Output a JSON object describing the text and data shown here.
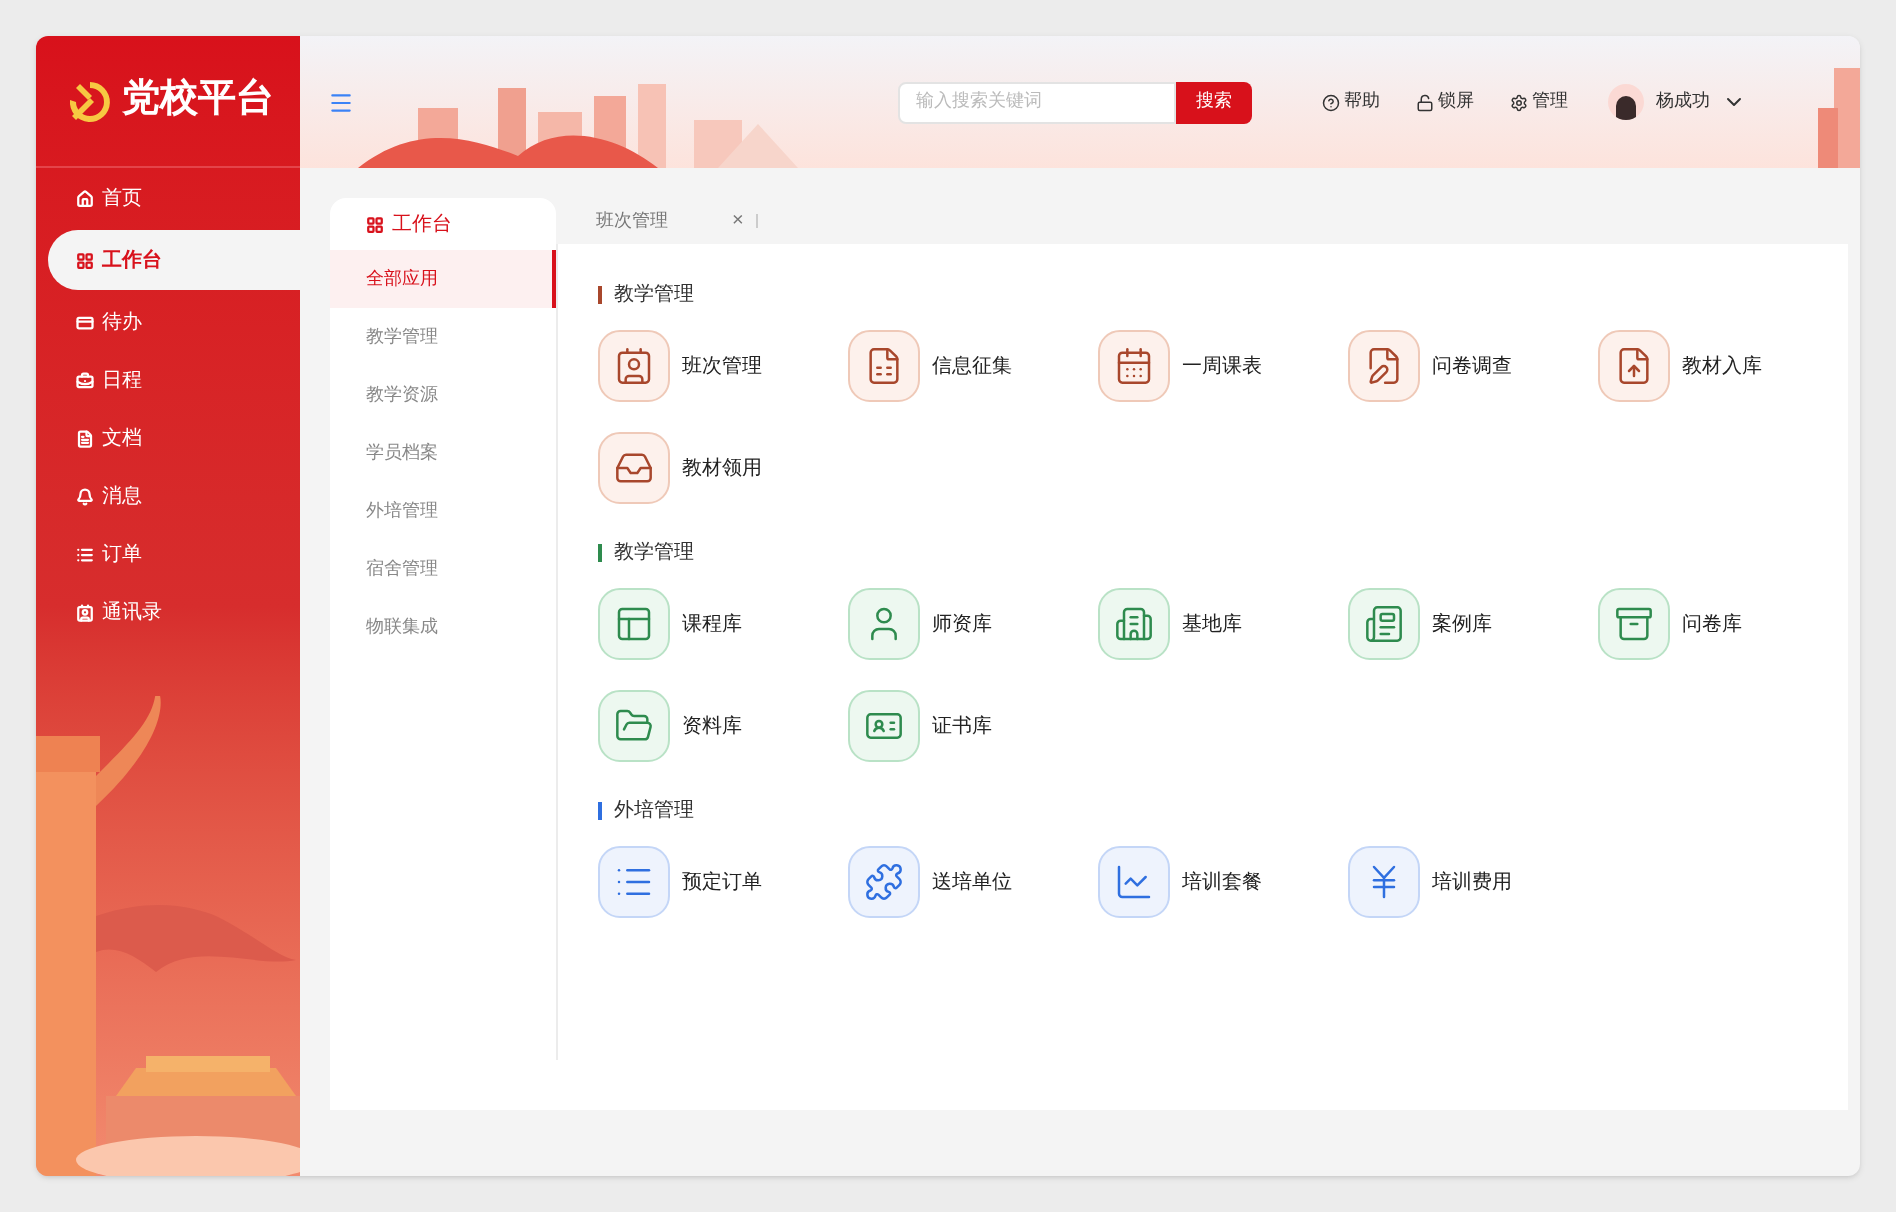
{
  "sidebar": {
    "logo": "党校平台",
    "items": [
      {
        "label": "首页",
        "selected": false
      },
      {
        "label": "工作台",
        "selected": true
      },
      {
        "label": "待办",
        "selected": false
      },
      {
        "label": "日程",
        "selected": false
      },
      {
        "label": "文档",
        "selected": false
      },
      {
        "label": "消息",
        "selected": false
      },
      {
        "label": "订单",
        "selected": false
      },
      {
        "label": "通讯录",
        "selected": false
      }
    ]
  },
  "header": {
    "search": {
      "placeholder": "输入搜索关键词",
      "button": "搜索"
    },
    "links": [
      "帮助",
      "锁屏",
      "管理"
    ],
    "user": "杨成功"
  },
  "panel": {
    "title": "工作台",
    "items": [
      {
        "label": "全部应用",
        "selected": true
      },
      {
        "label": "教学管理",
        "selected": false
      },
      {
        "label": "教学资源",
        "selected": false
      },
      {
        "label": "学员档案",
        "selected": false
      },
      {
        "label": "外培管理",
        "selected": false
      },
      {
        "label": "宿舍管理",
        "selected": false
      },
      {
        "label": "物联集成",
        "selected": false
      }
    ]
  },
  "tabs": [
    {
      "label": "班次管理",
      "close": "×"
    }
  ],
  "sections": [
    {
      "title": "教学管理",
      "color": "#a8472c",
      "apps": [
        "班次管理",
        "信息征集",
        "一周课表",
        "问卷调查",
        "教材入库",
        "教材领用"
      ]
    },
    {
      "title": "教学管理",
      "color": "#2e8b4e",
      "apps": [
        "课程库",
        "师资库",
        "基地库",
        "案例库",
        "问卷库",
        "资料库",
        "证书库"
      ]
    },
    {
      "title": "外培管理",
      "color": "#2f6fe0",
      "apps": [
        "预定订单",
        "送培单位",
        "培训套餐",
        "培训费用"
      ]
    }
  ]
}
